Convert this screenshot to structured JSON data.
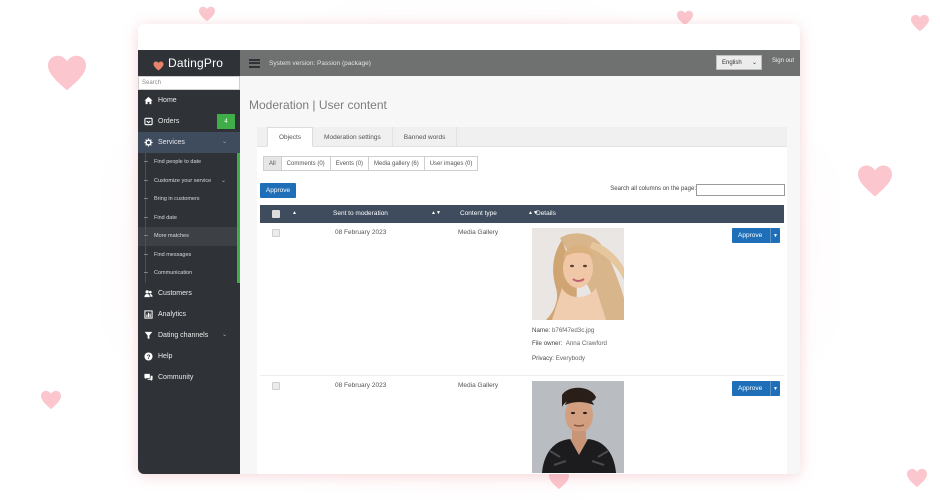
{
  "colors": {
    "accent_blue": "#1f6fb8",
    "sidebar_bg": "#2f3338",
    "table_header": "#3e4c5e",
    "badge_green": "#3fae49",
    "heart_pink": "#fbc6cd"
  },
  "brand": {
    "logo_text": "DatingPro",
    "logo_icon": "heart-icon"
  },
  "topbar": {
    "menu_icon": "hamburger-icon",
    "system_version": "System version: Passion (package)",
    "language": "English",
    "sign_out": "Sign out"
  },
  "sidebar": {
    "search_placeholder": "Search",
    "items": [
      {
        "label": "Home",
        "icon": "home-icon"
      },
      {
        "label": "Orders",
        "icon": "orders-icon",
        "badge": "4"
      },
      {
        "label": "Services",
        "icon": "gear-icon",
        "expanded": true
      },
      {
        "label": "Customers",
        "icon": "users-icon"
      },
      {
        "label": "Analytics",
        "icon": "chart-icon"
      },
      {
        "label": "Dating channels",
        "icon": "funnel-icon"
      },
      {
        "label": "Help",
        "icon": "help-icon"
      },
      {
        "label": "Community",
        "icon": "chat-icon"
      }
    ],
    "sub_items": [
      "Find people to date",
      "Customize your service",
      "Bring in customers",
      "Find date",
      "More matches",
      "Find messages",
      "Communication"
    ]
  },
  "page": {
    "title": "Moderation | User content",
    "tabs": [
      "Objects",
      "Moderation settings",
      "Banned words"
    ],
    "filters": [
      "All",
      "Comments (0)",
      "Events (0)",
      "Media gallery (6)",
      "User images (0)"
    ],
    "approve_label": "Approve",
    "search_label": "Search all columns on the page:",
    "table": {
      "headers": [
        "",
        "Sent to moderation",
        "Content type",
        "Details"
      ],
      "rows": [
        {
          "date": "08 February 2023",
          "type": "Media Gallery",
          "name_label": "Name:",
          "name": "b76f47ed3c.jpg",
          "owner_label": "File owner:",
          "owner": "Anna Crawford",
          "privacy_label": "Privacy:",
          "privacy": "Everybody",
          "approve": "Approve"
        },
        {
          "date": "08 February 2023",
          "type": "Media Gallery",
          "approve": "Approve"
        }
      ]
    }
  }
}
